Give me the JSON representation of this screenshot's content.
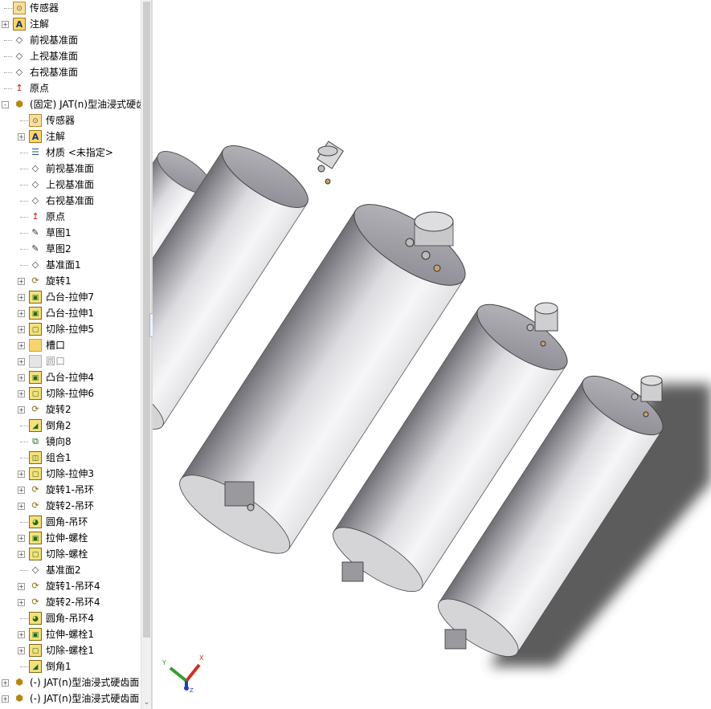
{
  "tree": {
    "items": [
      {
        "label": "传感器",
        "icon": "sensor-icon",
        "level": 1,
        "expand": ""
      },
      {
        "label": "注解",
        "icon": "annotation-icon",
        "level": 1,
        "expand": "+"
      },
      {
        "label": "前视基准面",
        "icon": "plane-icon",
        "level": 1,
        "expand": ""
      },
      {
        "label": "上视基准面",
        "icon": "plane-icon",
        "level": 1,
        "expand": ""
      },
      {
        "label": "右视基准面",
        "icon": "plane-icon",
        "level": 1,
        "expand": ""
      },
      {
        "label": "原点",
        "icon": "origin-icon",
        "level": 1,
        "expand": ""
      },
      {
        "label": "(固定) JAT(n)型油浸式硬齿",
        "icon": "part-icon",
        "level": 1,
        "expand": "-"
      },
      {
        "label": "传感器",
        "icon": "sensor-icon",
        "level": 2,
        "expand": ""
      },
      {
        "label": "注解",
        "icon": "annotation-icon",
        "level": 2,
        "expand": "+"
      },
      {
        "label": "材质 <未指定>",
        "icon": "material-icon",
        "level": 2,
        "expand": ""
      },
      {
        "label": "前视基准面",
        "icon": "plane-icon",
        "level": 2,
        "expand": ""
      },
      {
        "label": "上视基准面",
        "icon": "plane-icon",
        "level": 2,
        "expand": ""
      },
      {
        "label": "右视基准面",
        "icon": "plane-icon",
        "level": 2,
        "expand": ""
      },
      {
        "label": "原点",
        "icon": "origin-icon",
        "level": 2,
        "expand": ""
      },
      {
        "label": "草图1",
        "icon": "sketch-icon",
        "level": 2,
        "expand": ""
      },
      {
        "label": "草图2",
        "icon": "sketch-icon",
        "level": 2,
        "expand": ""
      },
      {
        "label": "基准面1",
        "icon": "plane-icon",
        "level": 2,
        "expand": ""
      },
      {
        "label": "旋转1",
        "icon": "revolve-icon",
        "level": 2,
        "expand": "+"
      },
      {
        "label": "凸台-拉伸7",
        "icon": "boss-extrude-icon",
        "level": 2,
        "expand": "+"
      },
      {
        "label": "凸台-拉伸1",
        "icon": "boss-extrude-icon",
        "level": 2,
        "expand": "+"
      },
      {
        "label": "切除-拉伸5",
        "icon": "cut-extrude-icon",
        "level": 2,
        "expand": "+"
      },
      {
        "label": "槽口",
        "icon": "folder-icon",
        "level": 2,
        "expand": "+"
      },
      {
        "label": "圆口",
        "icon": "folder-disabled-icon",
        "level": 2,
        "expand": "+",
        "disabled": true
      },
      {
        "label": "凸台-拉伸4",
        "icon": "boss-extrude-icon",
        "level": 2,
        "expand": "+"
      },
      {
        "label": "切除-拉伸6",
        "icon": "cut-extrude-icon",
        "level": 2,
        "expand": "+"
      },
      {
        "label": "旋转2",
        "icon": "revolve-icon",
        "level": 2,
        "expand": "+"
      },
      {
        "label": "倒角2",
        "icon": "chamfer-icon",
        "level": 2,
        "expand": ""
      },
      {
        "label": "镜向8",
        "icon": "mirror-icon",
        "level": 2,
        "expand": ""
      },
      {
        "label": "组合1",
        "icon": "combine-icon",
        "level": 2,
        "expand": ""
      },
      {
        "label": "切除-拉伸3",
        "icon": "cut-extrude-icon",
        "level": 2,
        "expand": "+"
      },
      {
        "label": "旋转1-吊环",
        "icon": "revolve-icon",
        "level": 2,
        "expand": "+"
      },
      {
        "label": "旋转2-吊环",
        "icon": "revolve-icon",
        "level": 2,
        "expand": "+"
      },
      {
        "label": "圆角-吊环",
        "icon": "fillet-icon",
        "level": 2,
        "expand": ""
      },
      {
        "label": "拉伸-螺栓",
        "icon": "boss-extrude-icon",
        "level": 2,
        "expand": "+"
      },
      {
        "label": "切除-螺栓",
        "icon": "cut-extrude-icon",
        "level": 2,
        "expand": "+"
      },
      {
        "label": "基准面2",
        "icon": "plane-icon",
        "level": 2,
        "expand": ""
      },
      {
        "label": "旋转1-吊环4",
        "icon": "revolve-icon",
        "level": 2,
        "expand": "+"
      },
      {
        "label": "旋转2-吊环4",
        "icon": "revolve-icon",
        "level": 2,
        "expand": "+"
      },
      {
        "label": "圆角-吊环4",
        "icon": "fillet-icon",
        "level": 2,
        "expand": ""
      },
      {
        "label": "拉伸-螺栓1",
        "icon": "boss-extrude-icon",
        "level": 2,
        "expand": "+"
      },
      {
        "label": "切除-螺栓1",
        "icon": "cut-extrude-icon",
        "level": 2,
        "expand": "+"
      },
      {
        "label": "倒角1",
        "icon": "chamfer-icon",
        "level": 2,
        "expand": ""
      },
      {
        "label": "(-) JAT(n)型油浸式硬齿面",
        "icon": "part-icon",
        "level": 1,
        "expand": "+"
      },
      {
        "label": "(-) JAT(n)型油浸式硬齿面",
        "icon": "part-icon",
        "level": 1,
        "expand": "+"
      }
    ]
  },
  "triad": {
    "x_label": "X",
    "y_label": "Y",
    "z_label": "Z"
  },
  "colors": {
    "panel_bg": "#ffffff",
    "scrollbar": "#f0f0f0",
    "cylinder_light": "#f4f4f6",
    "cylinder_dark": "#6d6c72",
    "shadow": "#4a4a4a"
  }
}
